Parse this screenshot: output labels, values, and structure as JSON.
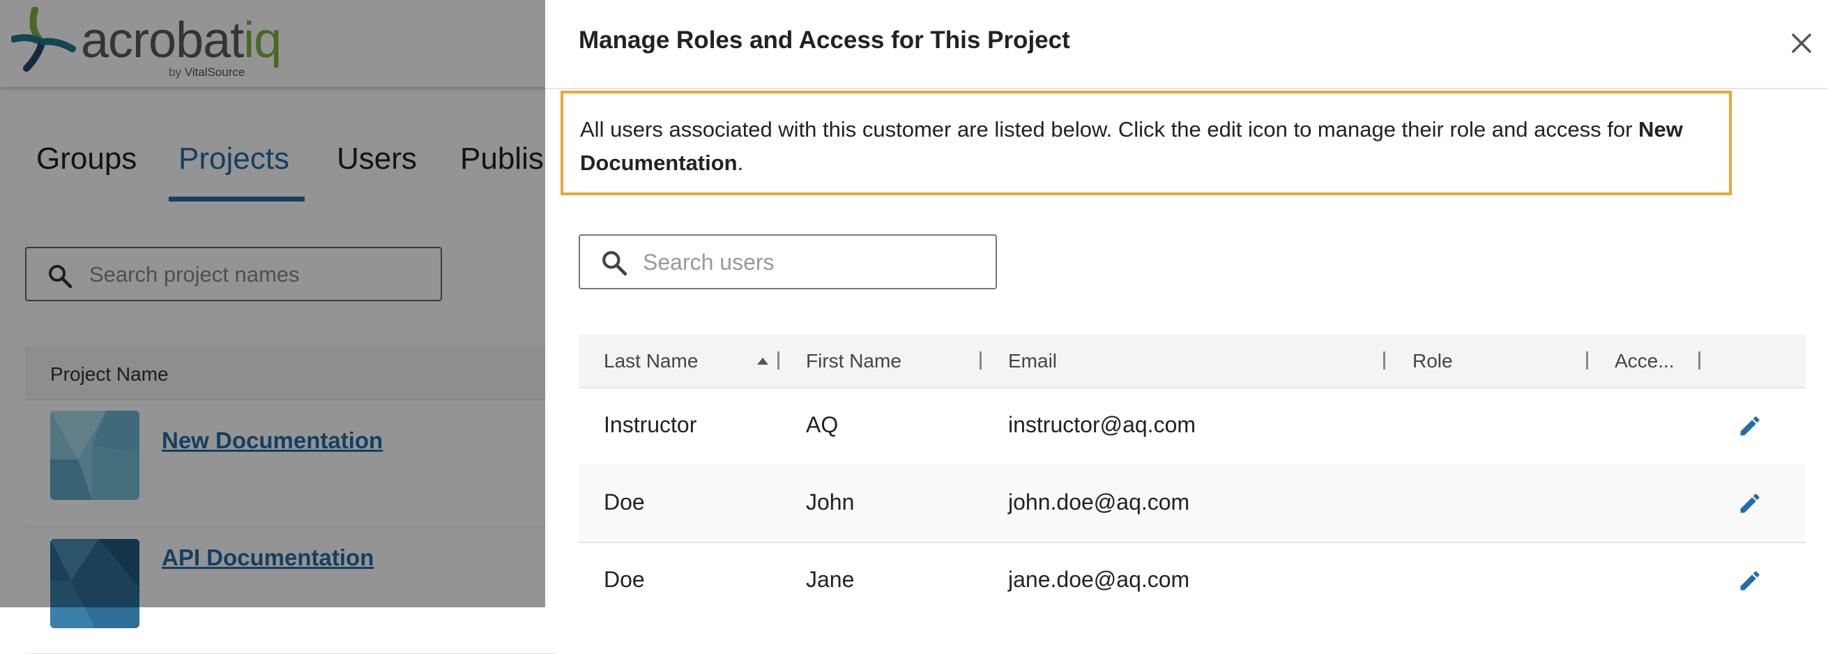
{
  "app": {
    "logo": {
      "word": "acrobat",
      "word_accent": "iq",
      "byline_prefix": "by ",
      "byline_brand": "VitalSource"
    },
    "tabs": [
      "Groups",
      "Projects",
      "Users",
      "Publis"
    ],
    "active_tab": "Projects",
    "project_search": {
      "placeholder": "Search project names"
    },
    "project_table": {
      "header": "Project Name",
      "rows": [
        {
          "name": "New Documentation"
        },
        {
          "name": "API Documentation"
        }
      ]
    }
  },
  "drawer": {
    "title": "Manage Roles and Access for This Project",
    "notice": {
      "text_before": "All users associated with this customer are listed below. Click the edit icon to manage their role and access for ",
      "project_name": "New Documentation",
      "text_after": "."
    },
    "search": {
      "placeholder": "Search users",
      "value": ""
    },
    "table": {
      "columns": [
        "Last Name",
        "First Name",
        "Email",
        "Role",
        "Acce..."
      ],
      "sorted_column": "Last Name",
      "sort_direction": "ascending",
      "rows": [
        {
          "last": "Instructor",
          "first": "AQ",
          "email": "instructor@aq.com",
          "role": "",
          "access": ""
        },
        {
          "last": "Doe",
          "first": "John",
          "email": "john.doe@aq.com",
          "role": "",
          "access": ""
        },
        {
          "last": "Doe",
          "first": "Jane",
          "email": "jane.doe@aq.com",
          "role": "",
          "access": ""
        }
      ]
    }
  },
  "colors": {
    "accent_blue": "#1f6fa7",
    "notice_border": "#f0a33b",
    "logo_green": "#7cb342",
    "logo_teal": "#1f7a8c",
    "logo_navy": "#234a6b"
  },
  "icons": {
    "search": "search-icon",
    "close": "close-icon",
    "edit": "pencil-icon",
    "sort": "sort-ascending-icon"
  }
}
